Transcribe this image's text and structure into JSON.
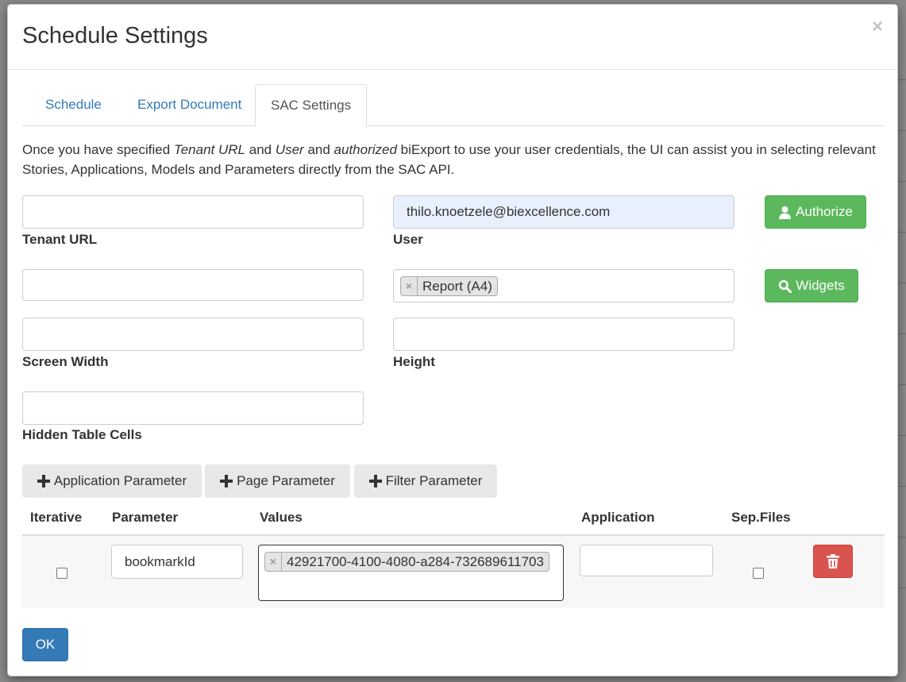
{
  "dialog": {
    "title": "Schedule Settings",
    "close_label": "×"
  },
  "tabs": [
    {
      "label": "Schedule"
    },
    {
      "label": "Export Document"
    },
    {
      "label": "SAC Settings"
    }
  ],
  "intro": {
    "part1": "Once you have specified ",
    "tenant_url": "Tenant URL",
    "part2": " and ",
    "user": "User",
    "part3": " and ",
    "authorized": "authorized",
    "part4": " biExport to use your user credentials, the UI can assist you in selecting relevant Stories, Applications, Models and Parameters directly from the SAC API."
  },
  "form": {
    "tenant_url": {
      "label": "Tenant URL",
      "value": ""
    },
    "user": {
      "label": "User",
      "value": "thilo.knoetzele@biexcellence.com"
    },
    "authorize_button": "Authorize",
    "story": {
      "value": ""
    },
    "widgets": {
      "tag": "Report (A4)",
      "remove": "×"
    },
    "widgets_button": "Widgets",
    "screen_width": {
      "label": "Screen Width",
      "value": ""
    },
    "height": {
      "label": "Height",
      "value": ""
    },
    "hidden_table_cells": {
      "label": "Hidden Table Cells",
      "value": ""
    }
  },
  "param_buttons": {
    "application": "Application Parameter",
    "page": "Page Parameter",
    "filter": "Filter Parameter"
  },
  "table": {
    "headers": {
      "iterative": "Iterative",
      "parameter": "Parameter",
      "values": "Values",
      "application": "Application",
      "sep_files": "Sep.Files"
    },
    "rows": [
      {
        "iterative": false,
        "parameter": "bookmarkId",
        "value_tag": "42921700-4100-4080-a284-732689611703",
        "value_remove": "×",
        "application": "",
        "sep_files": false
      }
    ]
  },
  "footer": {
    "ok_button": "OK"
  },
  "colors": {
    "success": "#5cb85c",
    "primary": "#337ab7",
    "danger": "#d9534f",
    "link": "#337ab7"
  }
}
